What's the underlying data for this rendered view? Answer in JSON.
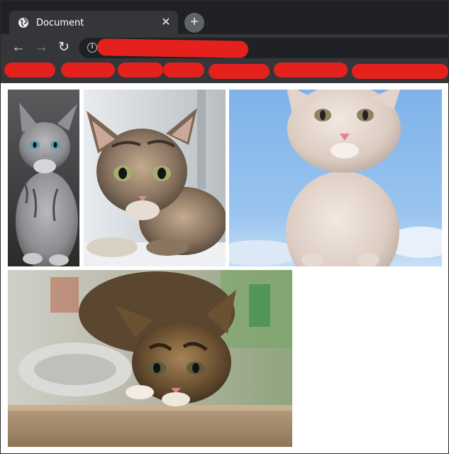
{
  "browser": {
    "tab": {
      "title": "Document",
      "favicon": "globe-icon",
      "close_glyph": "✕"
    },
    "new_tab_glyph": "+",
    "toolbar": {
      "back_glyph": "←",
      "forward_glyph": "→",
      "reload_glyph": "↻",
      "info_glyph": "i"
    },
    "colors": {
      "tabstrip": "#202124",
      "toolbar": "#35363a",
      "redaction": "#e5211e"
    }
  },
  "page": {
    "images": [
      {
        "subject": "gray tabby kitten sitting"
      },
      {
        "subject": "tabby kitten lying by window"
      },
      {
        "subject": "white kitten against blue sky"
      },
      {
        "subject": "calico kitten crouching on counter"
      }
    ]
  }
}
